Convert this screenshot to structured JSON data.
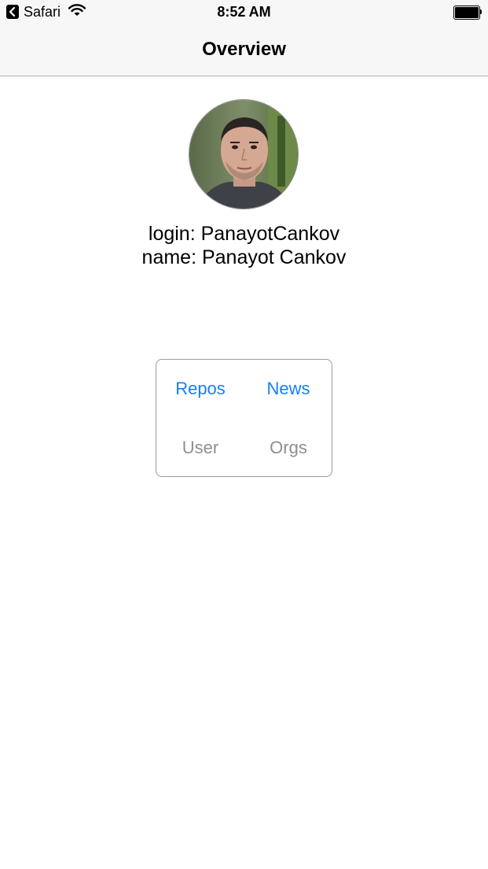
{
  "status_bar": {
    "back_app": "Safari",
    "time": "8:52 AM",
    "battery_level": 1.0
  },
  "nav": {
    "title": "Overview"
  },
  "profile": {
    "login_line": "login: PanayotCankov",
    "name_line": "name: Panayot Cankov"
  },
  "menu": {
    "items": [
      {
        "label": "Repos",
        "state": "enabled"
      },
      {
        "label": "News",
        "state": "enabled"
      },
      {
        "label": "User",
        "state": "disabled"
      },
      {
        "label": "Orgs",
        "state": "disabled"
      }
    ]
  },
  "colors": {
    "accent": "#157efb",
    "disabled": "#8e8e93",
    "bar_background": "#f7f7f7"
  },
  "icons": [
    "back-chevron-icon",
    "wifi-icon",
    "battery-icon"
  ]
}
